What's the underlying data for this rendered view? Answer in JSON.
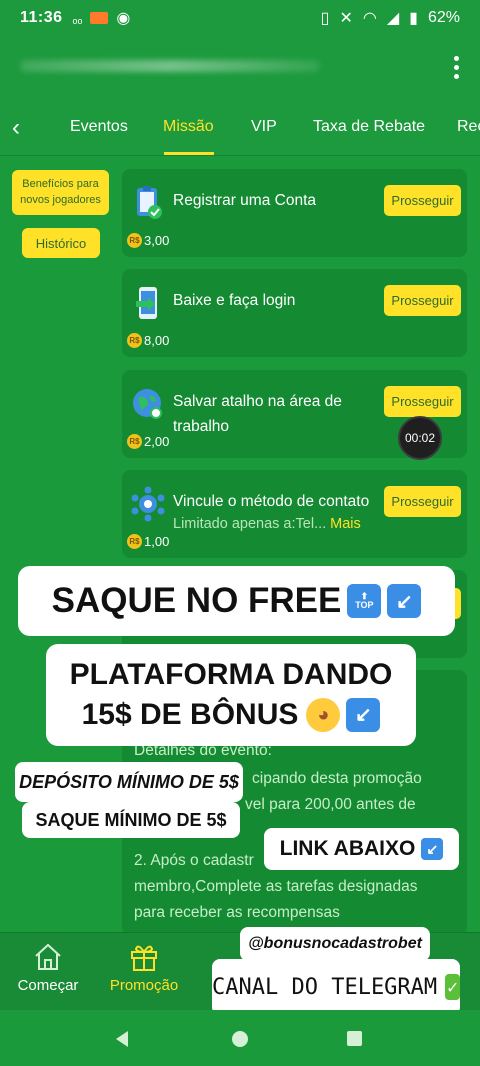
{
  "status": {
    "time": "11:36",
    "battery": "62%"
  },
  "tabs": [
    "Eventos",
    "Missão",
    "VIP",
    "Taxa de Rebate",
    "Rec"
  ],
  "active_tab": "Missão",
  "sidebar": {
    "benefits_label": "Benefícios para novos jogadores",
    "history_label": "Histórico"
  },
  "tasks": [
    {
      "title": "Registrar uma Conta",
      "button": "Prosseguir",
      "reward": "3,00",
      "icon": "clipboard-check-icon"
    },
    {
      "title": "Baixe e faça login",
      "button": "Prosseguir",
      "reward": "8,00",
      "icon": "phone-download-icon"
    },
    {
      "title": "Salvar atalho na área de trabalho",
      "button": "Prosseguir",
      "reward": "2,00",
      "icon": "globe-link-icon"
    },
    {
      "title": "Vincule o método de contato",
      "subtitle": "Limitado apenas a:Tel...",
      "more": "Mais",
      "button": "Prosseguir",
      "reward": "1,00",
      "icon": "contact-network-icon"
    }
  ],
  "coin_label": "R$",
  "timer": "00:02",
  "details": {
    "line1": "Detalhes do evento:",
    "line2": "cipando desta promoção",
    "line3": "vel para 200,00 antes de",
    "line4": "2. Após o cadastr",
    "line5": "membro,Complete as tarefas designadas",
    "line6": "para receber as recompensas"
  },
  "overlays": {
    "saque_free": "SAQUE NO FREE",
    "plataforma1": "PLATAFORMA DANDO",
    "plataforma2": "15$ DE BÔNUS",
    "deposito": "DEPÓSITO MÍNIMO DE 5$",
    "saque_min": "SAQUE MÍNIMO DE 5$",
    "link": "LINK ABAIXO",
    "handle": "@bonusnocadastrobet",
    "telegram": "CANAL DO TELEGRAM",
    "top_emoji": "TOP"
  },
  "bottom_nav": [
    {
      "label": "Começar",
      "icon": "home-icon"
    },
    {
      "label": "Promoção",
      "icon": "gift-icon"
    }
  ],
  "colors": {
    "background": "#1a9a3a",
    "card": "#148a33",
    "accent": "#ffe227"
  }
}
